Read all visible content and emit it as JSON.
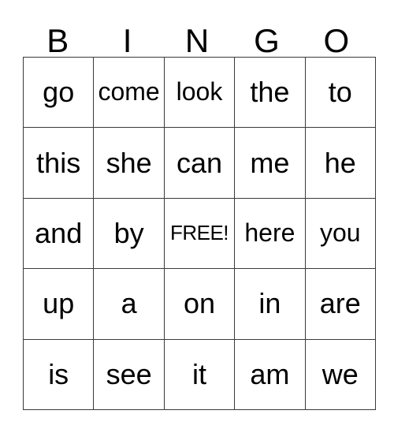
{
  "card": {
    "title": "BINGO",
    "header_letters": [
      "B",
      "I",
      "N",
      "G",
      "O"
    ],
    "free_space_label": "FREE!",
    "colors": {
      "background": "#ffffff",
      "text": "#000000",
      "grid_line": "#3a3a3a"
    },
    "grid": {
      "columns": 5,
      "rows": 5,
      "rows_data": [
        {
          "cells": [
            "go",
            "come",
            "look",
            "the",
            "to"
          ]
        },
        {
          "cells": [
            "this",
            "she",
            "can",
            "me",
            "he"
          ]
        },
        {
          "cells": [
            "and",
            "by",
            "FREE!",
            "here",
            "you"
          ]
        },
        {
          "cells": [
            "up",
            "a",
            "on",
            "in",
            "are"
          ]
        },
        {
          "cells": [
            "is",
            "see",
            "it",
            "am",
            "we"
          ]
        }
      ]
    }
  }
}
